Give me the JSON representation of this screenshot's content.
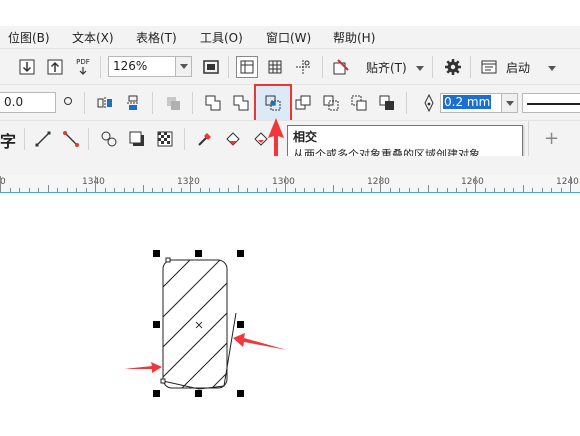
{
  "menu": [
    {
      "label": "位图(B)"
    },
    {
      "label": "文本(X)"
    },
    {
      "label": "表格(T)"
    },
    {
      "label": "工具(O)"
    },
    {
      "label": "窗口(W)"
    },
    {
      "label": "帮助(H)"
    }
  ],
  "toolbar": {
    "pdf_label": "PDF",
    "zoom_value": "126%",
    "snap_label": "贴齐(T)",
    "launch_label": "启动"
  },
  "propbar": {
    "coord_value": "0.0",
    "outline_width_value": "0.2 mm"
  },
  "toolbox": {
    "text_tool_label": "字",
    "add_label": "+"
  },
  "tooltip": {
    "title": "相交",
    "description": "从两个或多个对象重叠的区域创建对象."
  },
  "ruler": {
    "labels": [
      "0",
      "1340",
      "1320",
      "1300",
      "1280",
      "1260",
      "1240"
    ]
  },
  "colors": {
    "highlight_border": "#e53935",
    "arrow": "#f0383c",
    "selected_field": "#1a6fd0",
    "ruler_accent": "#45a8d6"
  }
}
